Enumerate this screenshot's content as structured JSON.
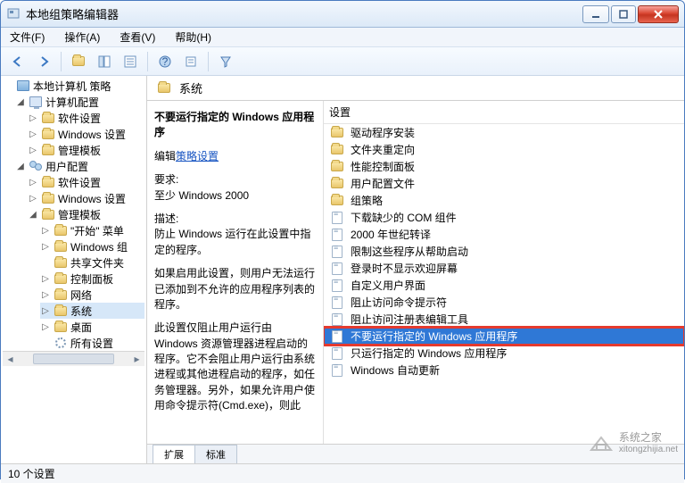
{
  "window": {
    "title": "本地组策略编辑器"
  },
  "menu": {
    "file": "文件(F)",
    "action": "操作(A)",
    "view": "查看(V)",
    "help": "帮助(H)"
  },
  "tree": {
    "root": "本地计算机 策略",
    "computer": {
      "label": "计算机配置",
      "children": {
        "sw": "软件设置",
        "win": "Windows 设置",
        "admin": "管理模板"
      }
    },
    "user": {
      "label": "用户配置",
      "children": {
        "sw": "软件设置",
        "win": "Windows 设置",
        "admin": {
          "label": "管理模板",
          "children": {
            "start": "\"开始\" 菜单",
            "wincomp": "Windows 组",
            "share": "共享文件夹",
            "cpanel": "控制面板",
            "network": "网络",
            "system": "系统",
            "desktop": "桌面",
            "all": "所有设置"
          }
        }
      }
    }
  },
  "right_header": "系统",
  "detail": {
    "setting_title": "不要运行指定的 Windows 应用程序",
    "edit_link_prefix": "编辑",
    "edit_link": "策略设置",
    "req_label": "要求:",
    "req_value": "至少 Windows 2000",
    "desc_label": "描述:",
    "desc1": "防止 Windows 运行在此设置中指定的程序。",
    "desc2": "如果启用此设置，则用户无法运行已添加到不允许的应用程序列表的程序。",
    "desc3": "此设置仅阻止用户运行由 Windows 资源管理器进程启动的程序。它不会阻止用户运行由系统进程或其他进程启动的程序，如任务管理器。另外，如果允许用户使用命令提示符(Cmd.exe)，则此"
  },
  "tabs": {
    "extended": "扩展",
    "standard": "标准"
  },
  "settings_header": "设置",
  "list": [
    {
      "type": "folder",
      "label": "驱动程序安装"
    },
    {
      "type": "folder",
      "label": "文件夹重定向"
    },
    {
      "type": "folder",
      "label": "性能控制面板"
    },
    {
      "type": "folder",
      "label": "用户配置文件"
    },
    {
      "type": "folder",
      "label": "组策略"
    },
    {
      "type": "page",
      "label": "下载缺少的 COM 组件"
    },
    {
      "type": "page",
      "label": "2000 年世纪转译"
    },
    {
      "type": "page",
      "label": "限制这些程序从帮助启动"
    },
    {
      "type": "page",
      "label": "登录时不显示欢迎屏幕"
    },
    {
      "type": "page",
      "label": "自定义用户界面"
    },
    {
      "type": "page",
      "label": "阻止访问命令提示符"
    },
    {
      "type": "page",
      "label": "阻止访问注册表编辑工具"
    },
    {
      "type": "page",
      "label": "不要运行指定的 Windows 应用程序",
      "highlight": true
    },
    {
      "type": "page",
      "label": "只运行指定的 Windows 应用程序"
    },
    {
      "type": "page",
      "label": "Windows 自动更新"
    }
  ],
  "status": "10 个设置",
  "watermark": {
    "brand": "系统之家",
    "url": "xitongzhijia.net"
  }
}
